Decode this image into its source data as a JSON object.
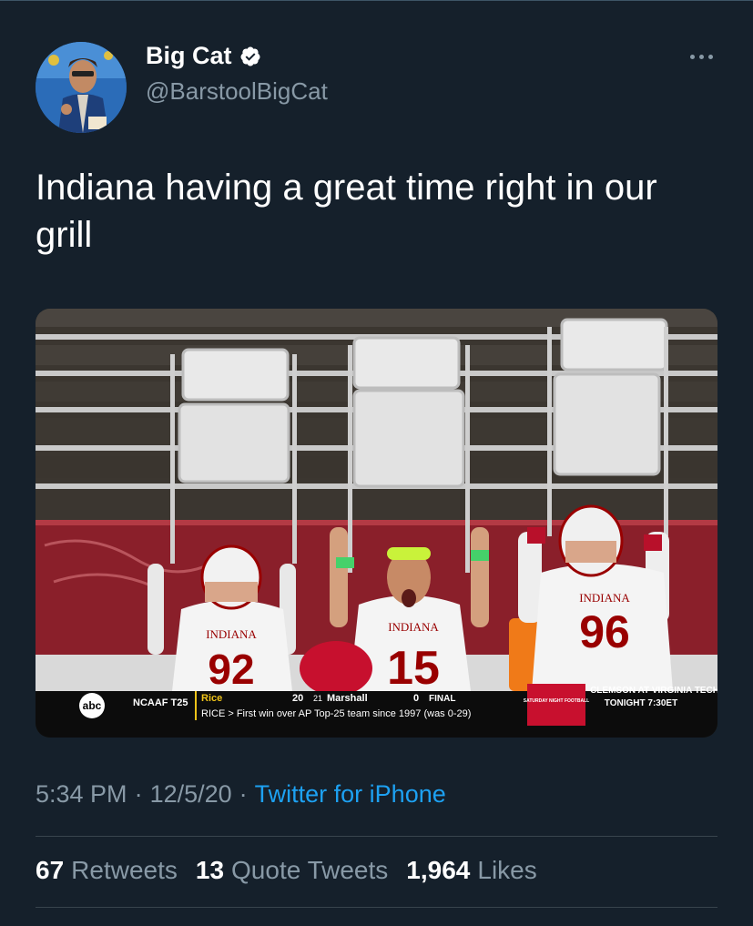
{
  "author": {
    "display_name": "Big Cat",
    "handle": "@BarstoolBigCat",
    "verified": true,
    "avatar": "avatar-photo"
  },
  "menu_icon": "more-dots-icon",
  "tweet": {
    "text": "Indiana having a great time right in our grill"
  },
  "media": {
    "description_icon": "photo",
    "players": [
      {
        "school": "INDIANA",
        "number": "92"
      },
      {
        "school": "INDIANA",
        "number": "15"
      },
      {
        "school": "INDIANA",
        "number": "96"
      }
    ],
    "scorebug": {
      "network": "abc",
      "league": "NCAAF T25",
      "team1": "Rice",
      "team1_score": "20",
      "team2_rank": "21",
      "team2": "Marshall",
      "team2_score": "0",
      "status": "FINAL",
      "ticker": "RICE >  First win over AP Top-25 team since 1997 (was 0-29)",
      "promo_left": "SATURDAY NIGHT FOOTBALL",
      "promo_line1": "CLEMSON AT VIRGINIA TECH",
      "promo_line2": "TONIGHT 7:30ET"
    }
  },
  "meta": {
    "time": "5:34 PM",
    "separator": "·",
    "date": "12/5/20",
    "source": "Twitter for iPhone"
  },
  "stats": {
    "retweets_count": "67",
    "retweets_label": "Retweets",
    "quotes_count": "13",
    "quotes_label": "Quote Tweets",
    "likes_count": "1,964",
    "likes_label": "Likes"
  },
  "colors": {
    "background": "#15202b",
    "secondary_text": "#8899a6",
    "link": "#1da1f2",
    "indiana_crimson": "#990000"
  }
}
